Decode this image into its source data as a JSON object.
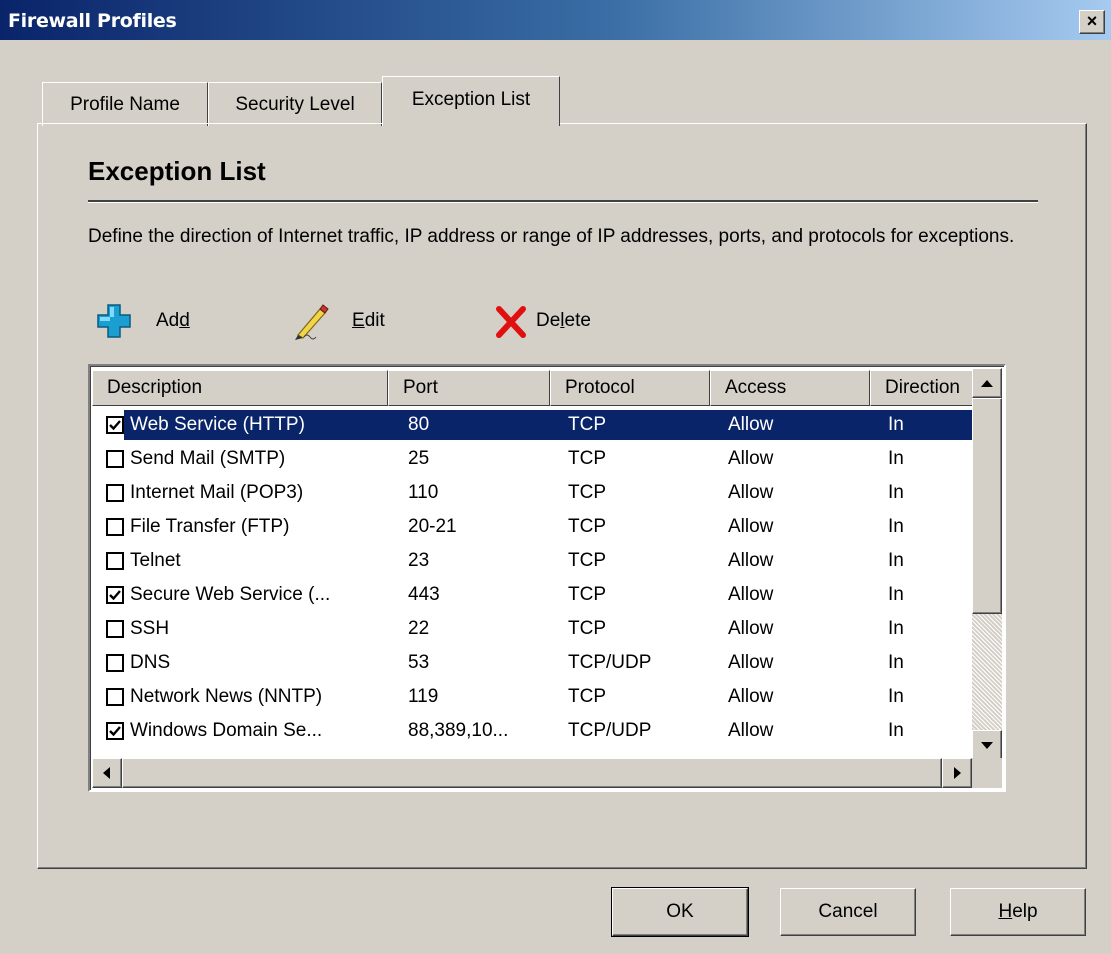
{
  "window": {
    "title": "Firewall Profiles",
    "close_label": "×"
  },
  "tabs": [
    {
      "label": "Profile Name"
    },
    {
      "label": "Security Level"
    },
    {
      "label": "Exception List"
    }
  ],
  "panel": {
    "heading": "Exception List",
    "description": "Define the direction of Internet traffic, IP address or range of IP addresses, ports, and protocols for exceptions."
  },
  "toolbar": {
    "add": {
      "pre": "Ad",
      "accel": "d",
      "post": "",
      "icon": "add-icon"
    },
    "edit": {
      "pre": "",
      "accel": "E",
      "post": "dit",
      "icon": "pencil-icon"
    },
    "delete": {
      "pre": "De",
      "accel": "l",
      "post": "ete",
      "icon": "delete-x-icon"
    }
  },
  "list": {
    "columns": [
      "Description",
      "Port",
      "Protocol",
      "Access",
      "Direction"
    ],
    "rows": [
      {
        "checked": true,
        "selected": true,
        "description": "Web Service (HTTP)",
        "port": "80",
        "protocol": "TCP",
        "access": "Allow",
        "direction": "In"
      },
      {
        "checked": false,
        "selected": false,
        "description": "Send Mail (SMTP)",
        "port": "25",
        "protocol": "TCP",
        "access": "Allow",
        "direction": "In"
      },
      {
        "checked": false,
        "selected": false,
        "description": "Internet Mail (POP3)",
        "port": "110",
        "protocol": "TCP",
        "access": "Allow",
        "direction": "In"
      },
      {
        "checked": false,
        "selected": false,
        "description": "File Transfer (FTP)",
        "port": "20-21",
        "protocol": "TCP",
        "access": "Allow",
        "direction": "In"
      },
      {
        "checked": false,
        "selected": false,
        "description": "Telnet",
        "port": "23",
        "protocol": "TCP",
        "access": "Allow",
        "direction": "In"
      },
      {
        "checked": true,
        "selected": false,
        "description": "Secure Web Service (...",
        "port": "443",
        "protocol": "TCP",
        "access": "Allow",
        "direction": "In"
      },
      {
        "checked": false,
        "selected": false,
        "description": "SSH",
        "port": "22",
        "protocol": "TCP",
        "access": "Allow",
        "direction": "In"
      },
      {
        "checked": false,
        "selected": false,
        "description": "DNS",
        "port": "53",
        "protocol": "TCP/UDP",
        "access": "Allow",
        "direction": "In"
      },
      {
        "checked": false,
        "selected": false,
        "description": "Network News (NNTP)",
        "port": "119",
        "protocol": "TCP",
        "access": "Allow",
        "direction": "In"
      },
      {
        "checked": true,
        "selected": false,
        "description": "Windows Domain Se...",
        "port": "88,389,10...",
        "protocol": "TCP/UDP",
        "access": "Allow",
        "direction": "In"
      }
    ]
  },
  "buttons": {
    "ok": "OK",
    "cancel": "Cancel",
    "help": {
      "accel": "H",
      "post": "elp"
    }
  }
}
